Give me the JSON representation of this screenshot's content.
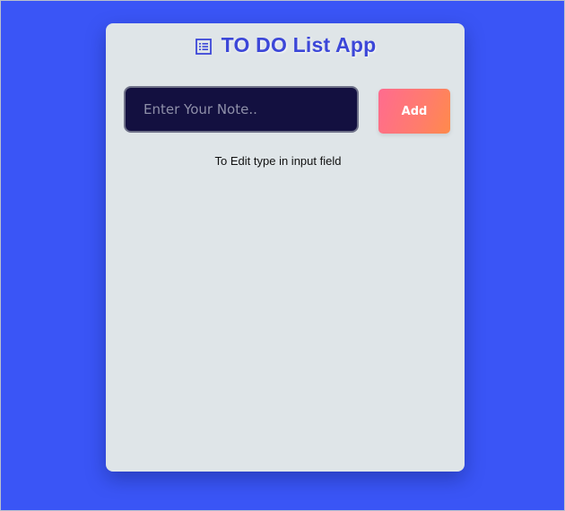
{
  "app": {
    "title": "TO DO List App",
    "title_icon": "list-icon"
  },
  "form": {
    "note_input_value": "",
    "note_input_placeholder": "Enter Your Note..",
    "add_label": "Add"
  },
  "hint": {
    "text": "To Edit type in input field"
  },
  "colors": {
    "background": "#3a55f6",
    "card": "#dfe5e8",
    "title": "#3c47d8",
    "input_bg": "#131040",
    "button_gradient_start": "#ff6b8f",
    "button_gradient_end": "#ff8a4b"
  },
  "todos": []
}
